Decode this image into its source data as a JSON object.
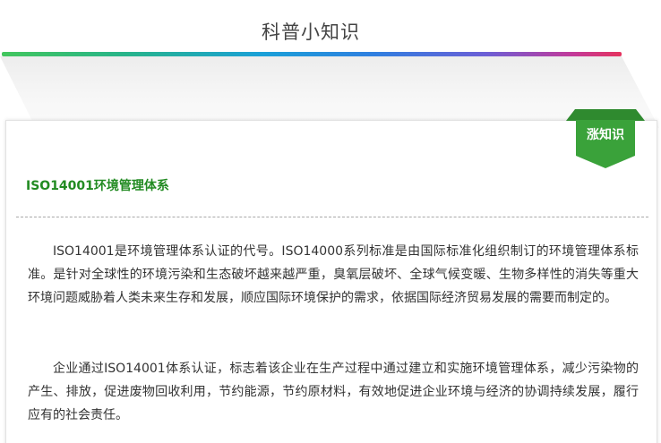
{
  "section": {
    "title": "科普小知识"
  },
  "badge": {
    "label": "涨知识"
  },
  "article": {
    "heading": "ISO14001环境管理体系",
    "paragraphs": [
      "ISO14001是环境管理体系认证的代号。ISO14000系列标准是由国际标准化组织制订的环境管理体系标准。是针对全球性的环境污染和生态破坏越来越严重，臭氧层破坏、全球气候变暖、生物多样性的消失等重大环境问题威胁着人类未来生存和发展，顺应国际环境保护的需求，依据国际经济贸易发展的需要而制定的。",
      "企业通过ISO14001体系认证，标志着该企业在生产过程中通过建立和实施环境管理体系，减少污染物的产生、排放，促进废物回收利用，节约能源，节约原材料，有效地促进企业环境与经济的协调持续发展，履行应有的社会责任。"
    ]
  },
  "colors": {
    "accent_green": "#3aa23a",
    "heading_green": "#228b22",
    "gradient": [
      "#43c65d",
      "#1aa0d8",
      "#6b5fd6",
      "#e5335e"
    ]
  }
}
